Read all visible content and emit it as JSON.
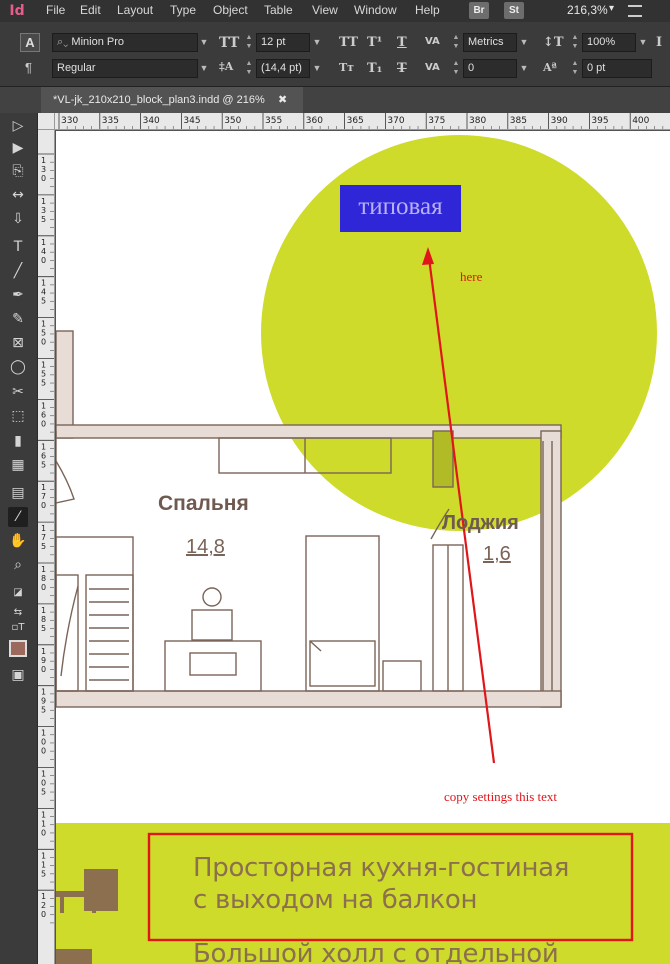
{
  "app": {
    "icon_text": "Id",
    "menu": [
      "File",
      "Edit",
      "Layout",
      "Type",
      "Object",
      "Table",
      "View",
      "Window",
      "Help"
    ],
    "badges": [
      "Br",
      "St"
    ],
    "zoom": "216,3%"
  },
  "control": {
    "font_family": "Minion Pro",
    "font_style": "Regular",
    "font_size": "12 pt",
    "leading": "(14,4 pt)",
    "kerning": "Metrics",
    "tracking": "0",
    "vertical_scale": "100%",
    "baseline_shift": "0 pt"
  },
  "tab": {
    "title": "*VL-jk_210x210_block_plan3.indd @ 216%",
    "close": "✖"
  },
  "ruler": {
    "top_labels": [
      "330",
      "335",
      "340",
      "345",
      "350",
      "355",
      "360",
      "365",
      "370",
      "375",
      "380",
      "385",
      "390",
      "395",
      "400"
    ],
    "left_labels": [
      {
        "d": [
          "1",
          "3",
          "0"
        ]
      },
      {
        "d": [
          "1",
          "3",
          "5"
        ]
      },
      {
        "d": [
          "1",
          "4",
          "0"
        ]
      },
      {
        "d": [
          "1",
          "4",
          "5"
        ]
      },
      {
        "d": [
          "1",
          "5",
          "0"
        ]
      },
      {
        "d": [
          "1",
          "5",
          "5"
        ]
      },
      {
        "d": [
          "1",
          "6",
          "0"
        ]
      },
      {
        "d": [
          "1",
          "6",
          "5"
        ]
      },
      {
        "d": [
          "1",
          "7",
          "0"
        ]
      },
      {
        "d": [
          "1",
          "7",
          "5"
        ]
      },
      {
        "d": [
          "1",
          "8",
          "0"
        ]
      },
      {
        "d": [
          "1",
          "8",
          "5"
        ]
      },
      {
        "d": [
          "1",
          "9",
          "0"
        ]
      },
      {
        "d": [
          "1",
          "9",
          "5"
        ]
      },
      {
        "d": [
          "1",
          "0",
          "0"
        ]
      },
      {
        "d": [
          "1",
          "0",
          "5"
        ]
      },
      {
        "d": [
          "1",
          "1",
          "0"
        ]
      },
      {
        "d": [
          "1",
          "1",
          "5"
        ]
      },
      {
        "d": [
          "1",
          "2",
          "0"
        ]
      }
    ]
  },
  "plan": {
    "room1_name": "Спальня",
    "room1_area": "14,8",
    "room2_name": "Лоджия",
    "room2_area": "1,6",
    "selected_text": "типовая",
    "note_here": "here",
    "note_copy": "copy settings  this text",
    "feature1_line1": "Просторная кухня-гостиная",
    "feature1_line2": "с выходом на балкон",
    "feature2_line1": "Большой холл с отдельной"
  },
  "colors": {
    "lime": "#cedb2a",
    "selection": "#2f26d8",
    "annotation_red": "#e0161b",
    "plan_brown": "#7a6458",
    "feature_text": "#8b6f4e"
  }
}
